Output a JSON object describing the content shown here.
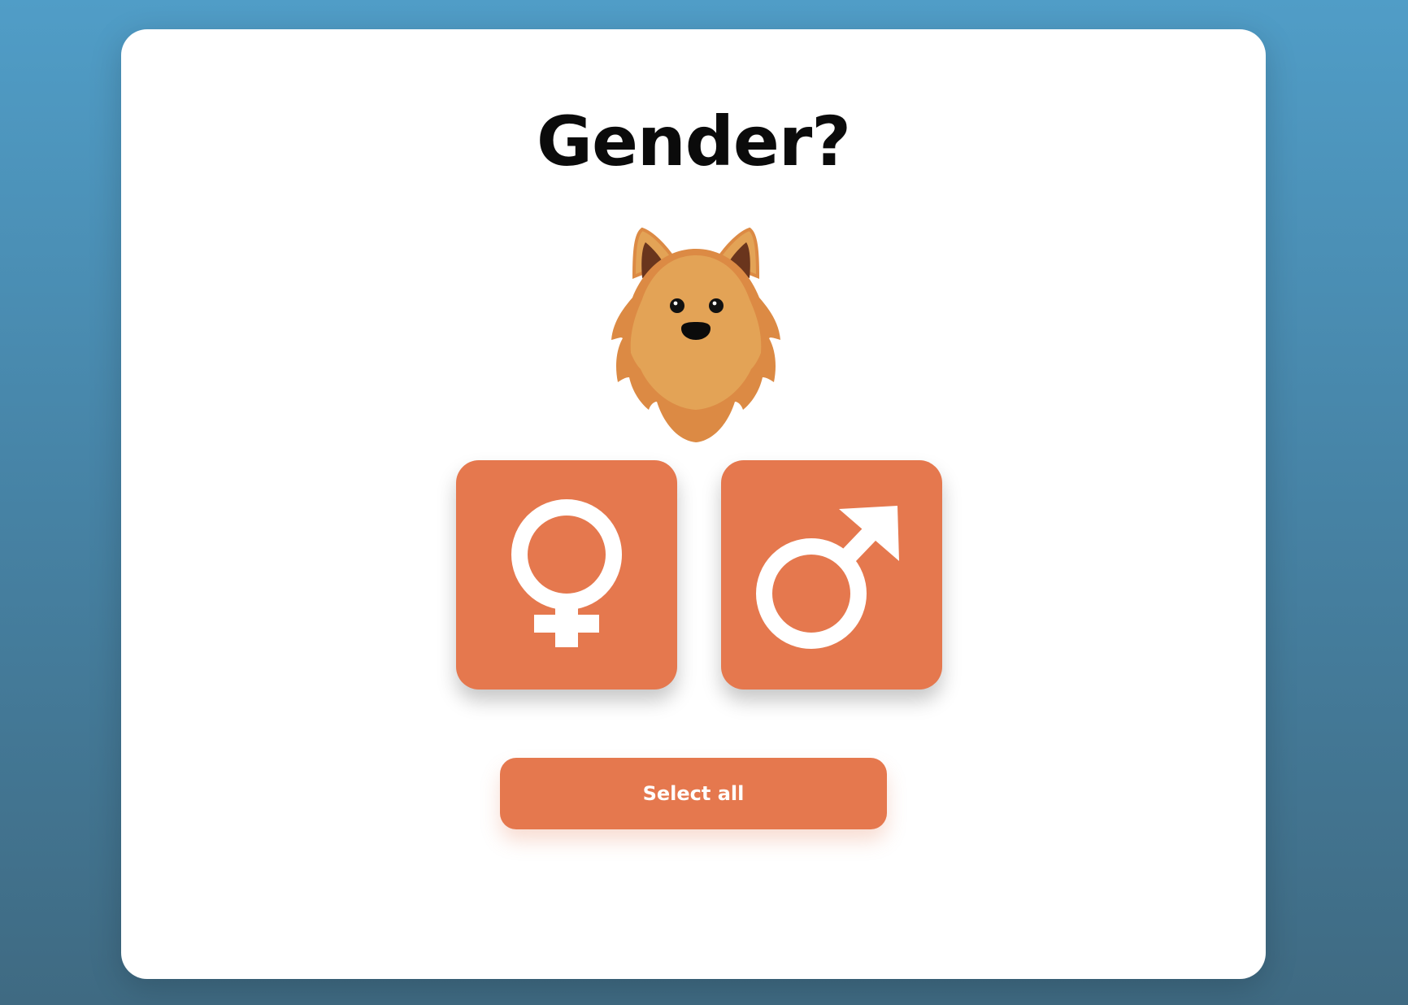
{
  "page": {
    "title": "Gender?"
  },
  "mascot": {
    "icon": "dog-face-icon"
  },
  "options": [
    {
      "icon": "female-symbol-icon"
    },
    {
      "icon": "male-symbol-icon"
    }
  ],
  "actions": {
    "select_all_label": "Select all"
  },
  "colors": {
    "accent": "#e5784e",
    "card_background": "#ffffff",
    "page_background_top": "#509dc7",
    "page_background_bottom": "#3f6a82",
    "title_text": "#0b0b0b",
    "mascot_fur": "#e3a356",
    "mascot_fur_dark": "#dc8a44",
    "mascot_ear_inner": "#6a351d"
  }
}
